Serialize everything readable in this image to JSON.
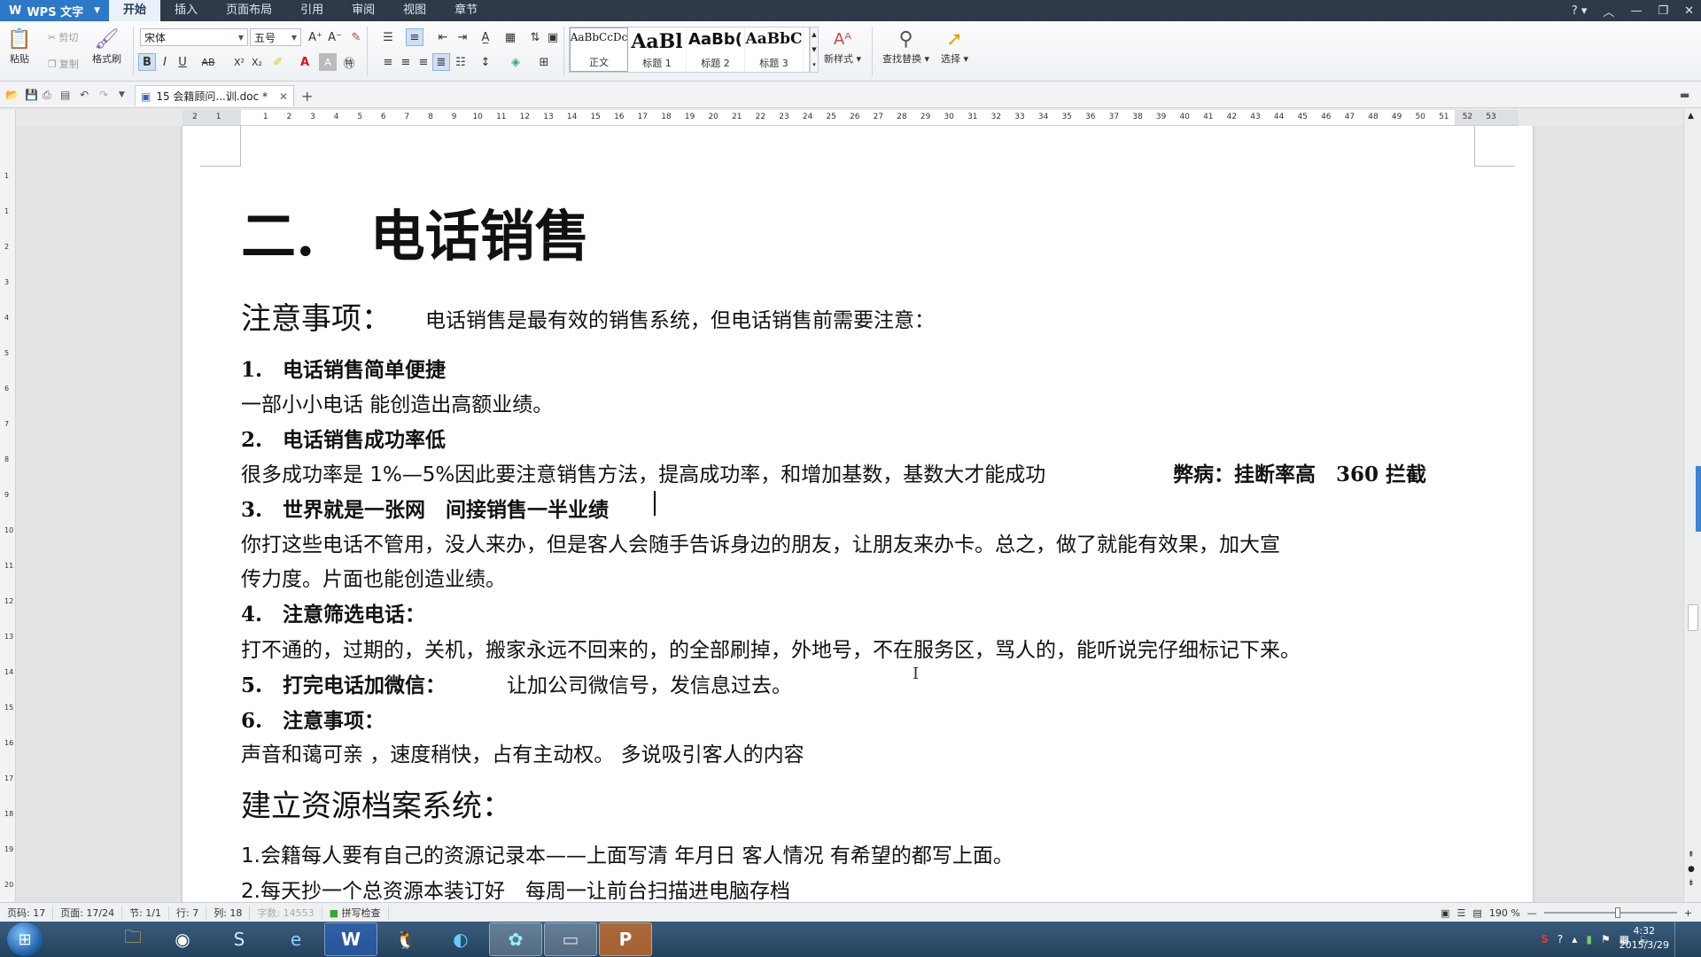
{
  "app": {
    "name": "WPS 文字",
    "menu_tabs": [
      "开始",
      "插入",
      "页面布局",
      "引用",
      "审阅",
      "视图",
      "章节"
    ],
    "active_tab": "开始",
    "help": "?"
  },
  "ribbon": {
    "paste": "粘贴",
    "cut": "剪切",
    "copy": "复制",
    "format_painter": "格式刷",
    "font_name": "宋体",
    "font_size": "五号",
    "styles": [
      {
        "sample": "AaBbCcDc",
        "name": "正文"
      },
      {
        "sample": "AaBl",
        "name": "标题 1"
      },
      {
        "sample": "AaBb(",
        "name": "标题 2"
      },
      {
        "sample": "AaBbC",
        "name": "标题 3"
      }
    ],
    "new_style": "新样式",
    "find_replace": "查找替换",
    "select": "选择"
  },
  "doc_tab": {
    "label": "15 会籍顾问...训.doc *"
  },
  "ruler": {
    "numbers": [
      "2",
      "1",
      "",
      "1",
      "2",
      "3",
      "4",
      "5",
      "6",
      "7",
      "8",
      "9",
      "10",
      "11",
      "12",
      "13",
      "14",
      "15",
      "16",
      "17",
      "18",
      "19",
      "20",
      "21",
      "22",
      "23",
      "24",
      "25",
      "26",
      "27",
      "28",
      "29",
      "30",
      "31",
      "32",
      "33",
      "34",
      "35",
      "36",
      "37",
      "38",
      "39",
      "40",
      "41",
      "42",
      "43",
      "44",
      "45",
      "46",
      "47",
      "48",
      "49",
      "50",
      "51",
      "52",
      "53"
    ]
  },
  "vruler": {
    "numbers": [
      "1",
      "1",
      "2",
      "3",
      "4",
      "5",
      "6",
      "7",
      "8",
      "9",
      "10",
      "11",
      "12",
      "13",
      "14",
      "15",
      "16",
      "17",
      "18",
      "19",
      "20"
    ]
  },
  "document": {
    "heading": "二.　电话销售",
    "notes_label": "注意事项：",
    "notes_text": "电话销售是最有效的销售系统，但电话销售前需要注意：",
    "item1_title": "1.　电话销售简单便捷",
    "item1_text": "一部小小电话  能创造出高额业绩。",
    "item2_title": "2.　电话销售成功率低",
    "item2_text": "很多成功率是 1%—5%因此要注意销售方法，提高成功率，和增加基数，基数大才能成功",
    "item2_bold": "弊病：挂断率高　360 拦截",
    "item3_title": "3.　世界就是一张网　间接销售一半业绩",
    "item3_text_line1": "你打这些电话不管用，没人来办，但是客人会随手告诉身边的朋友，让朋友来办卡。总之，做了就能有效果，加大宣",
    "item3_text_line2": "传力度。片面也能创造业绩。",
    "item4_title": "4.　注意筛选电话：",
    "item4_text": "打不通的，过期的，关机，搬家永远不回来的，的全部刷掉，外地号，不在服务区，骂人的，能听说完仔细标记下来。",
    "item5_title": "5.　打完电话加微信：",
    "item5_text": "让加公司微信号，发信息过去。",
    "item6_title": "6.　注意事项：",
    "item6_text": "声音和蔼可亲 ，速度稍快，占有主动权。 多说吸引客人的内容",
    "section2_title": "建立资源档案系统：",
    "s2_item1": "1.会籍每人要有自己的资源记录本——上面写清  年月日  客人情况  有希望的都写上面。",
    "s2_item2": "2.每天抄一个总资源本装订好　每周一让前台扫描进电脑存档"
  },
  "status": {
    "page_code": "页码: 17",
    "page": "页面: 17/24",
    "section": "节: 1/1",
    "row": "行: 7",
    "col": "列: 18",
    "word_count": "字数: 14553",
    "spell_check": "拼写检查",
    "zoom": "190 %"
  },
  "taskbar": {
    "apps": [
      "file-explorer",
      "browser-360",
      "sogou",
      "browser-360se",
      "wps-writer",
      "qq",
      "app-blue",
      "qq-video",
      "image-viewer",
      "wps-presentation"
    ],
    "time": "4:32",
    "date": "2015/3/29"
  }
}
